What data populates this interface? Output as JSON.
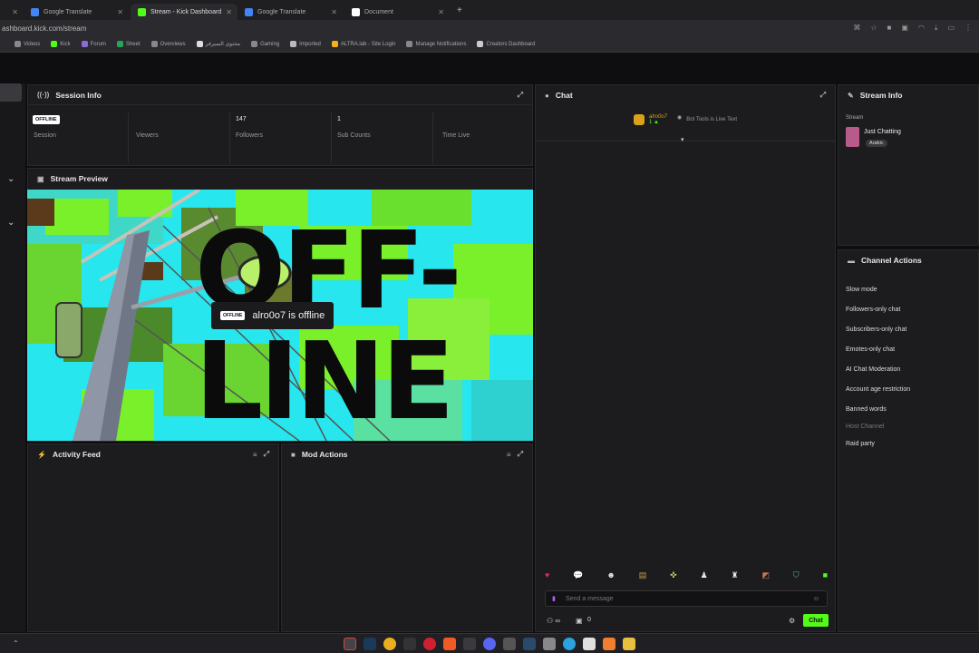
{
  "browser": {
    "tabs": [
      {
        "label": "Google Translate",
        "color": "#4285f4"
      },
      {
        "label": "Stream - Kick Dashboard",
        "color": "#53fc18"
      },
      {
        "label": "Google Translate",
        "color": "#4285f4"
      },
      {
        "label": "Document",
        "color": "#ffffff"
      }
    ],
    "url": "ashboard.kick.com/stream",
    "bookmarks": [
      "Videos",
      "Kick",
      "Forum",
      "Sheet",
      "Overviews",
      "محتوى السيرفر",
      "Gaming",
      "Imported",
      "ALTRA.lab - Site Login",
      "Manage Notifications",
      "Creators Dashboard"
    ]
  },
  "session_info": {
    "title": "Session Info",
    "badge": "OFFLINE",
    "stats": [
      {
        "value": "",
        "label": "Session"
      },
      {
        "value": "",
        "label": "Viewers"
      },
      {
        "value": "147",
        "label": "Followers"
      },
      {
        "value": "1",
        "label": "Sub Counts"
      },
      {
        "value": "",
        "label": "Time Live"
      }
    ]
  },
  "stream_preview": {
    "title": "Stream Preview",
    "big_line1": "OFF-",
    "big_line2": "LINE",
    "badge": "OFFLINE",
    "status_text": "alro0o7 is offline"
  },
  "activity_feed": {
    "title": "Activity Feed"
  },
  "mod_actions": {
    "title": "Mod Actions"
  },
  "chat": {
    "title": "Chat",
    "username": "alro0o7",
    "count": "1",
    "notice": "Bot Tools is Live Text",
    "input_placeholder": "Send a message",
    "footer_count": "0",
    "send_label": "Chat",
    "emotes": [
      "#e0245e",
      "#ffffff",
      "#ffffff",
      "#c9a14a",
      "#b7d86a",
      "#ffffff",
      "#ffffff",
      "#c27a5a",
      "#5fb0a0",
      "#53fc18"
    ]
  },
  "stream_info": {
    "title": "Stream Info",
    "label": "Stream",
    "category": "Just Chatting",
    "tag": "Arabic"
  },
  "channel_actions": {
    "title": "Channel Actions",
    "items": [
      {
        "label": "Slow mode",
        "dim": false
      },
      {
        "label": "Followers-only chat",
        "dim": false
      },
      {
        "label": "Subscribers-only chat",
        "dim": false
      },
      {
        "label": "Emotes-only chat",
        "dim": false
      },
      {
        "label": "AI Chat Moderation",
        "dim": false
      },
      {
        "label": "Account age restriction",
        "dim": false
      },
      {
        "label": "Banned words",
        "dim": false
      },
      {
        "label": "Host Channel",
        "dim": true
      },
      {
        "label": "Raid party",
        "dim": false
      }
    ]
  },
  "colors": {
    "accent": "#53fc18",
    "panel": "#1c1c1f",
    "preview_cyan": "#27e6ee",
    "preview_green": "#7af02a"
  }
}
